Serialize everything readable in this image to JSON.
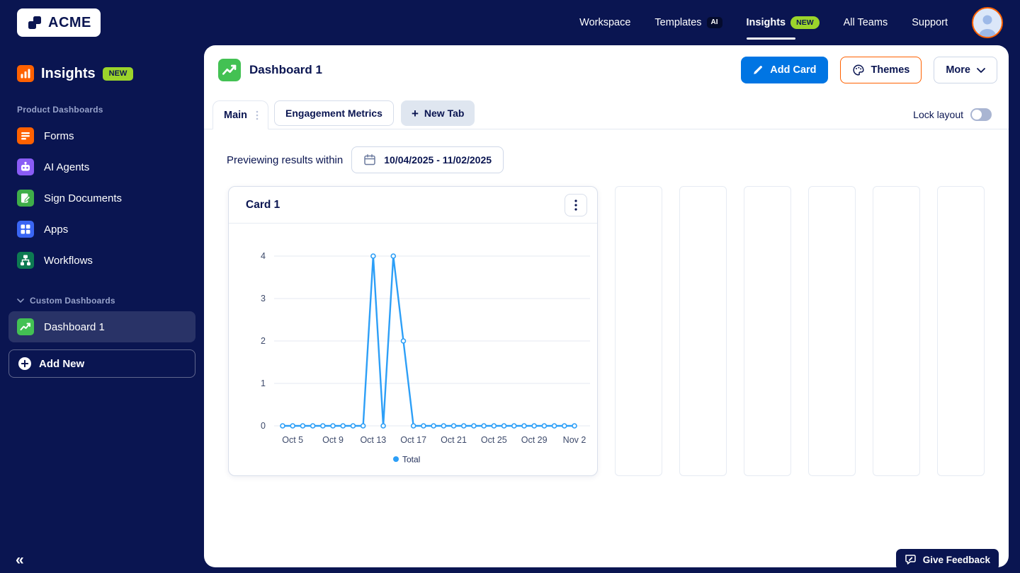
{
  "nav": {
    "brand": "ACME",
    "items": [
      {
        "label": "Workspace"
      },
      {
        "label": "Templates",
        "badge": "AI"
      },
      {
        "label": "Insights",
        "badge": "NEW"
      },
      {
        "label": "All Teams"
      },
      {
        "label": "Support"
      }
    ]
  },
  "sidebar": {
    "title": "Insights",
    "title_badge": "NEW",
    "section_products": "Product Dashboards",
    "items": [
      {
        "label": "Forms"
      },
      {
        "label": "AI Agents"
      },
      {
        "label": "Sign Documents"
      },
      {
        "label": "Apps"
      },
      {
        "label": "Workflows"
      }
    ],
    "section_custom": "Custom Dashboards",
    "dashboard_item": "Dashboard 1",
    "add_new": "Add New",
    "collapse": "«"
  },
  "main": {
    "title": "Dashboard 1",
    "add_card": "Add Card",
    "themes": "Themes",
    "more": "More",
    "tabs": {
      "main": "Main",
      "engagement": "Engagement Metrics",
      "new_tab": "New Tab"
    },
    "lock_layout": "Lock layout",
    "preview_label": "Previewing results within",
    "date_range": "10/04/2025 - 11/02/2025",
    "card_title": "Card 1"
  },
  "feedback": "Give Feedback",
  "chart_data": {
    "type": "line",
    "title": "Card 1",
    "x": [
      "Oct 4",
      "Oct 5",
      "Oct 6",
      "Oct 7",
      "Oct 8",
      "Oct 9",
      "Oct 10",
      "Oct 11",
      "Oct 12",
      "Oct 13",
      "Oct 14",
      "Oct 15",
      "Oct 16",
      "Oct 17",
      "Oct 18",
      "Oct 19",
      "Oct 20",
      "Oct 21",
      "Oct 22",
      "Oct 23",
      "Oct 24",
      "Oct 25",
      "Oct 26",
      "Oct 27",
      "Oct 28",
      "Oct 29",
      "Oct 30",
      "Oct 31",
      "Nov 1",
      "Nov 2"
    ],
    "series": [
      {
        "name": "Total",
        "values": [
          0,
          0,
          0,
          0,
          0,
          0,
          0,
          0,
          0,
          4,
          0,
          4,
          2,
          0,
          0,
          0,
          0,
          0,
          0,
          0,
          0,
          0,
          0,
          0,
          0,
          0,
          0,
          0,
          0,
          0
        ]
      }
    ],
    "xticks": [
      {
        "label": "Oct 5",
        "index": 1
      },
      {
        "label": "Oct 9",
        "index": 5
      },
      {
        "label": "Oct 13",
        "index": 9
      },
      {
        "label": "Oct 17",
        "index": 13
      },
      {
        "label": "Oct 21",
        "index": 17
      },
      {
        "label": "Oct 25",
        "index": 21
      },
      {
        "label": "Oct 29",
        "index": 25
      },
      {
        "label": "Nov 2",
        "index": 29
      }
    ],
    "yticks": [
      0,
      1,
      2,
      3,
      4
    ],
    "ylim": [
      0,
      4
    ],
    "grid": true,
    "legend_position": "bottom",
    "line_color": "#2d9ff7"
  },
  "colors": {
    "navy": "#0a1551",
    "primary_blue": "#0075e3",
    "accent_orange": "#ff6100",
    "lime_badge": "#9bd42b",
    "chart_line": "#2d9ff7",
    "dashboard_green": "#43c153"
  }
}
